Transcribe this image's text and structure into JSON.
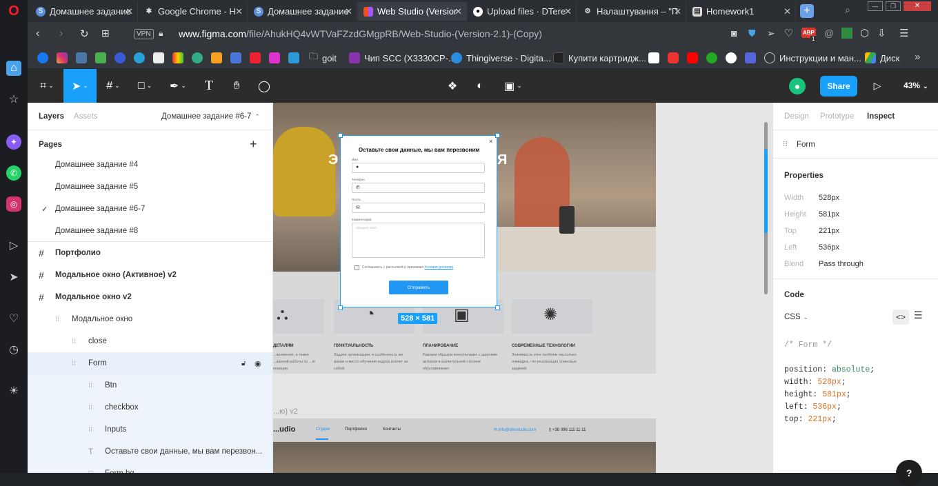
{
  "browser": {
    "tabs": [
      {
        "label": "Домашнее задание",
        "icon": "s-icon",
        "active": false
      },
      {
        "label": "Google Chrome - H",
        "icon": "puzzle-icon",
        "active": false
      },
      {
        "label": "Домашнее задание",
        "icon": "s-icon",
        "active": false
      },
      {
        "label": "Web Studio (Versior",
        "icon": "figma-icon",
        "active": true
      },
      {
        "label": "Upload files · DTere",
        "icon": "github-icon",
        "active": false
      },
      {
        "label": "Налаштування – \"П",
        "icon": "gear-icon",
        "active": false
      },
      {
        "label": "Homework1",
        "icon": "document-icon",
        "active": false
      }
    ],
    "vpn_label": "VPN",
    "url_host": "www.figma.com",
    "url_path": "/file/AhukHQ4vWTVaFZzdGMgpRB/Web-Studio-(Version-2.1)-(Copy)",
    "extension_badge": "ABP",
    "extension_badge_count": "1",
    "bookmarks": [
      {
        "label": "goit",
        "icon": "folder-icon"
      },
      {
        "label": "Чип SCC (X3330CP-...",
        "icon": "bookmark-icon"
      },
      {
        "label": "Thingiverse - Digita...",
        "icon": "thingiverse-icon"
      },
      {
        "label": "Купити картридж...",
        "icon": "bookmark-icon"
      },
      {
        "label": "Инструкции и ман...",
        "icon": "bookmark-icon"
      },
      {
        "label": "Диск",
        "icon": "drive-icon"
      }
    ]
  },
  "figma": {
    "share_label": "Share",
    "zoom": "43%",
    "left_tabs": {
      "layers": "Layers",
      "assets": "Assets",
      "page": "Домашнее задание #6-7"
    },
    "pages_title": "Pages",
    "pages": [
      {
        "label": "Домашнее задание #4",
        "checked": false
      },
      {
        "label": "Домашнее задание #5",
        "checked": false
      },
      {
        "label": "Домашнее задание #6-7",
        "checked": true
      },
      {
        "label": "Домашнее задание #8",
        "checked": false
      }
    ],
    "layers": [
      {
        "label": "Портфолио",
        "type": "frame",
        "indent": 0,
        "bold": true
      },
      {
        "label": "Модальное окно (Активное) v2",
        "type": "frame",
        "indent": 0,
        "bold": true
      },
      {
        "label": "Модальное окно v2",
        "type": "frame",
        "indent": 0,
        "bold": true
      },
      {
        "label": "Модальное окно",
        "type": "group",
        "indent": 1,
        "bold": false
      },
      {
        "label": "close",
        "type": "group",
        "indent": 2,
        "bold": false
      },
      {
        "label": "Form",
        "type": "group",
        "indent": 2,
        "bold": false,
        "selected": true
      },
      {
        "label": "Btn",
        "type": "group",
        "indent": 3,
        "bold": false
      },
      {
        "label": "checkbox",
        "type": "group",
        "indent": 3,
        "bold": false
      },
      {
        "label": "Inputs",
        "type": "group",
        "indent": 3,
        "bold": false
      },
      {
        "label": "Оставьте свои данные, мы вам перезвон...",
        "type": "text",
        "indent": 3,
        "bold": false
      },
      {
        "label": "Form bg",
        "type": "rect",
        "indent": 3,
        "bold": false
      }
    ],
    "right_tabs": {
      "design": "Design",
      "prototype": "Prototype",
      "inspect": "Inspect"
    },
    "selection_name": "Form",
    "properties_title": "Properties",
    "properties": [
      {
        "key": "Width",
        "value": "528px"
      },
      {
        "key": "Height",
        "value": "581px"
      },
      {
        "key": "Top",
        "value": "221px"
      },
      {
        "key": "Left",
        "value": "536px"
      },
      {
        "key": "Blend",
        "value": "Pass through"
      }
    ],
    "code_title": "Code",
    "code_lang": "CSS",
    "code_comment": "/* Form */",
    "code_lines": [
      {
        "prop": "position",
        "value": "absolute"
      },
      {
        "prop": "width",
        "value": "528px"
      },
      {
        "prop": "height",
        "value": "581px"
      },
      {
        "prop": "left",
        "value": "536px"
      },
      {
        "prop": "top",
        "value": "221px"
      }
    ],
    "help_label": "?"
  },
  "canvas": {
    "hero_text_left": "Э",
    "hero_text_right": "Я",
    "selection_size": "528 × 581",
    "modal": {
      "title": "Оставьте свои данные, мы вам перезвоним",
      "close": "×",
      "name_label": "Имя",
      "phone_label": "Телефон",
      "email_label": "Почта",
      "comment_label": "Комментарий",
      "comment_placeholder": "Введите текст",
      "consent_text": "Соглашаюсь с рассылкой и принимаю",
      "consent_link": "Условия договора",
      "submit": "Отправить"
    },
    "features": [
      {
        "title": "ДЕТАЛЯМ",
        "text": "...вражения, а также ...ванной работы по ...ю позиции."
      },
      {
        "title": "ПУНКТУАЛЬНОСТЬ",
        "text": "Задача организации, в особенности же рамки и место обучения кадров влечет за собой."
      },
      {
        "title": "ПЛАНИРОВАНИЕ",
        "text": "Равным образом консультация с широким активом в значительной степени обуславливает."
      },
      {
        "title": "СОВРЕМЕННЫЕ ТЕХНОЛОГИИ",
        "text": "Значимость этих проблем настолько очевидна, что реализация плановых заданий."
      }
    ],
    "frame_label": "...ю) v2",
    "nav": {
      "logo": "...udio",
      "links": [
        "Студия",
        "Портфолио",
        "Контакты"
      ],
      "email": "info@devstudio.com",
      "phone": "+38 096 111 11 11"
    }
  }
}
